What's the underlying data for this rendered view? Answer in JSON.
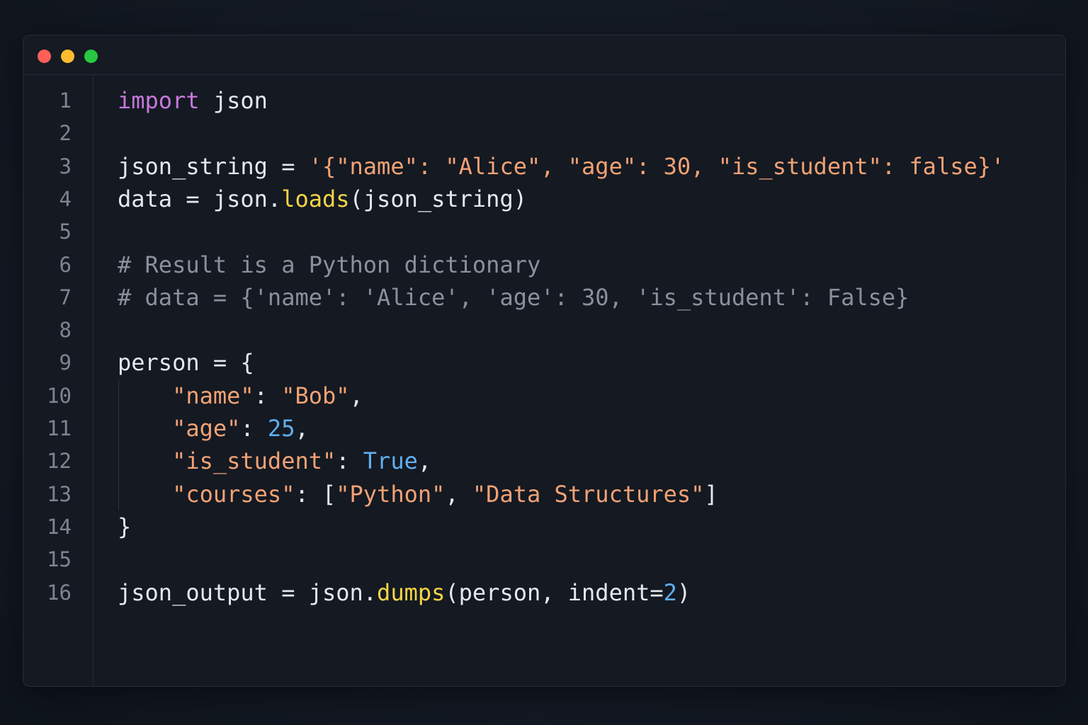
{
  "editor": {
    "window_controls": [
      {
        "name": "close",
        "color": "#ff5f57"
      },
      {
        "name": "minimize",
        "color": "#febc2e"
      },
      {
        "name": "maximize",
        "color": "#28c840"
      }
    ],
    "colors": {
      "keyword": "#c678dd",
      "string": "#f2a274",
      "function": "#f5d547",
      "number": "#61afef",
      "comment": "#8a919c",
      "plain": "#e6e8eb"
    },
    "lines": [
      {
        "num": "1",
        "tokens": [
          {
            "t": "import",
            "k": "kw"
          },
          {
            "t": " json",
            "k": "pl"
          }
        ]
      },
      {
        "num": "2",
        "tokens": []
      },
      {
        "num": "3",
        "tokens": [
          {
            "t": "json_string = ",
            "k": "pl"
          },
          {
            "t": "'{\"name\": \"Alice\", \"age\": 30, \"is_student\": false}'",
            "k": "str"
          }
        ]
      },
      {
        "num": "4",
        "tokens": [
          {
            "t": "data = json.",
            "k": "pl"
          },
          {
            "t": "loads",
            "k": "fn"
          },
          {
            "t": "(json_string)",
            "k": "pl"
          }
        ]
      },
      {
        "num": "5",
        "tokens": []
      },
      {
        "num": "6",
        "tokens": [
          {
            "t": "# Result is a Python dictionary",
            "k": "cmt"
          }
        ]
      },
      {
        "num": "7",
        "tokens": [
          {
            "t": "# data = {'name': 'Alice', 'age': 30, 'is_student': False}",
            "k": "cmt"
          }
        ]
      },
      {
        "num": "8",
        "tokens": []
      },
      {
        "num": "9",
        "tokens": [
          {
            "t": "person = {",
            "k": "pl"
          }
        ]
      },
      {
        "num": "10",
        "tokens": [
          {
            "t": "    ",
            "k": "pl"
          },
          {
            "t": "\"name\"",
            "k": "str"
          },
          {
            "t": ": ",
            "k": "pl"
          },
          {
            "t": "\"Bob\"",
            "k": "str"
          },
          {
            "t": ",",
            "k": "pl"
          }
        ]
      },
      {
        "num": "11",
        "tokens": [
          {
            "t": "    ",
            "k": "pl"
          },
          {
            "t": "\"age\"",
            "k": "str"
          },
          {
            "t": ": ",
            "k": "pl"
          },
          {
            "t": "25",
            "k": "num"
          },
          {
            "t": ",",
            "k": "pl"
          }
        ]
      },
      {
        "num": "12",
        "tokens": [
          {
            "t": "    ",
            "k": "pl"
          },
          {
            "t": "\"is_student\"",
            "k": "str"
          },
          {
            "t": ": ",
            "k": "pl"
          },
          {
            "t": "True",
            "k": "const"
          },
          {
            "t": ",",
            "k": "pl"
          }
        ]
      },
      {
        "num": "13",
        "tokens": [
          {
            "t": "    ",
            "k": "pl"
          },
          {
            "t": "\"courses\"",
            "k": "str"
          },
          {
            "t": ": [",
            "k": "pl"
          },
          {
            "t": "\"Python\"",
            "k": "str"
          },
          {
            "t": ", ",
            "k": "pl"
          },
          {
            "t": "\"Data Structures\"",
            "k": "str"
          },
          {
            "t": "]",
            "k": "pl"
          }
        ]
      },
      {
        "num": "14",
        "tokens": [
          {
            "t": "}",
            "k": "pl"
          }
        ]
      },
      {
        "num": "15",
        "tokens": []
      },
      {
        "num": "16",
        "tokens": [
          {
            "t": "json_output = json.",
            "k": "pl"
          },
          {
            "t": "dumps",
            "k": "fn"
          },
          {
            "t": "(person, indent=",
            "k": "pl"
          },
          {
            "t": "2",
            "k": "num"
          },
          {
            "t": ")",
            "k": "pl"
          }
        ]
      }
    ]
  }
}
